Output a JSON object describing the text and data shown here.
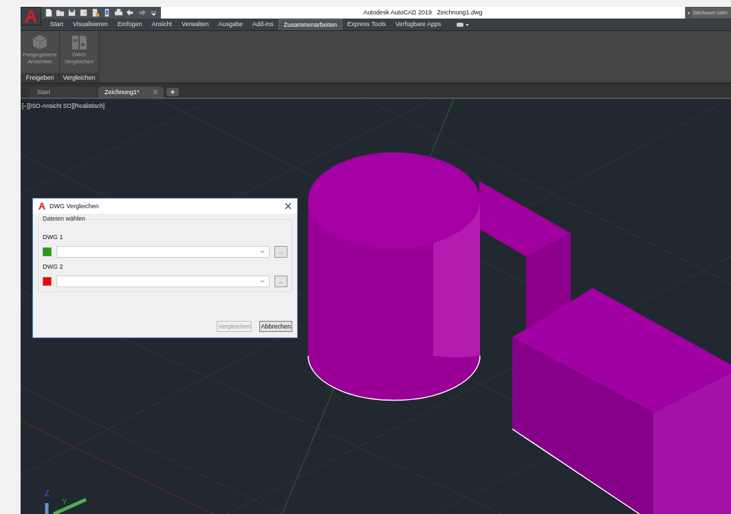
{
  "app": {
    "title": "Autodesk AutoCAD 2019",
    "file": "Zeichnung1.dwg",
    "search_placeholder": "Stichwort oder"
  },
  "ribbon_tabs": [
    {
      "label": "Start",
      "selected": false
    },
    {
      "label": "Visualisieren",
      "selected": false
    },
    {
      "label": "Einfügen",
      "selected": false
    },
    {
      "label": "Ansicht",
      "selected": false
    },
    {
      "label": "Verwalten",
      "selected": false
    },
    {
      "label": "Ausgabe",
      "selected": false
    },
    {
      "label": "Add-ins",
      "selected": false
    },
    {
      "label": "Zusammenarbeiten",
      "selected": true
    },
    {
      "label": "Express Tools",
      "selected": false
    },
    {
      "label": "Verfügbare Apps",
      "selected": false
    }
  ],
  "ribbon_panels": [
    {
      "label": "Freigeben",
      "buttons": [
        {
          "label": "Freigegebene Ansichten",
          "kind": "cube",
          "disabled": true
        }
      ]
    },
    {
      "label": "Vergleichen",
      "buttons": [
        {
          "label": "DWG Vergleichen",
          "kind": "compare",
          "disabled": true
        }
      ]
    }
  ],
  "file_tabs": [
    {
      "label": "Start",
      "selected": false,
      "closable": false
    },
    {
      "label": "Zeichnung1*",
      "selected": true,
      "closable": true
    }
  ],
  "viewport": {
    "label": "[−][ISO-Ansicht SO][Realistisch]",
    "axis_z": "Z",
    "axis_y": "Y"
  },
  "dialog": {
    "title": "DWG Vergleichen",
    "group": "Dateien wählen",
    "files": [
      {
        "label": "DWG 1",
        "color": "#22a00a",
        "browse": "..."
      },
      {
        "label": "DWG 2",
        "color": "#ff0000",
        "browse": "..."
      }
    ],
    "buttons": [
      {
        "label": "Vergleichen",
        "disabled": true
      },
      {
        "label": "Abbrechen",
        "disabled": false
      }
    ]
  }
}
